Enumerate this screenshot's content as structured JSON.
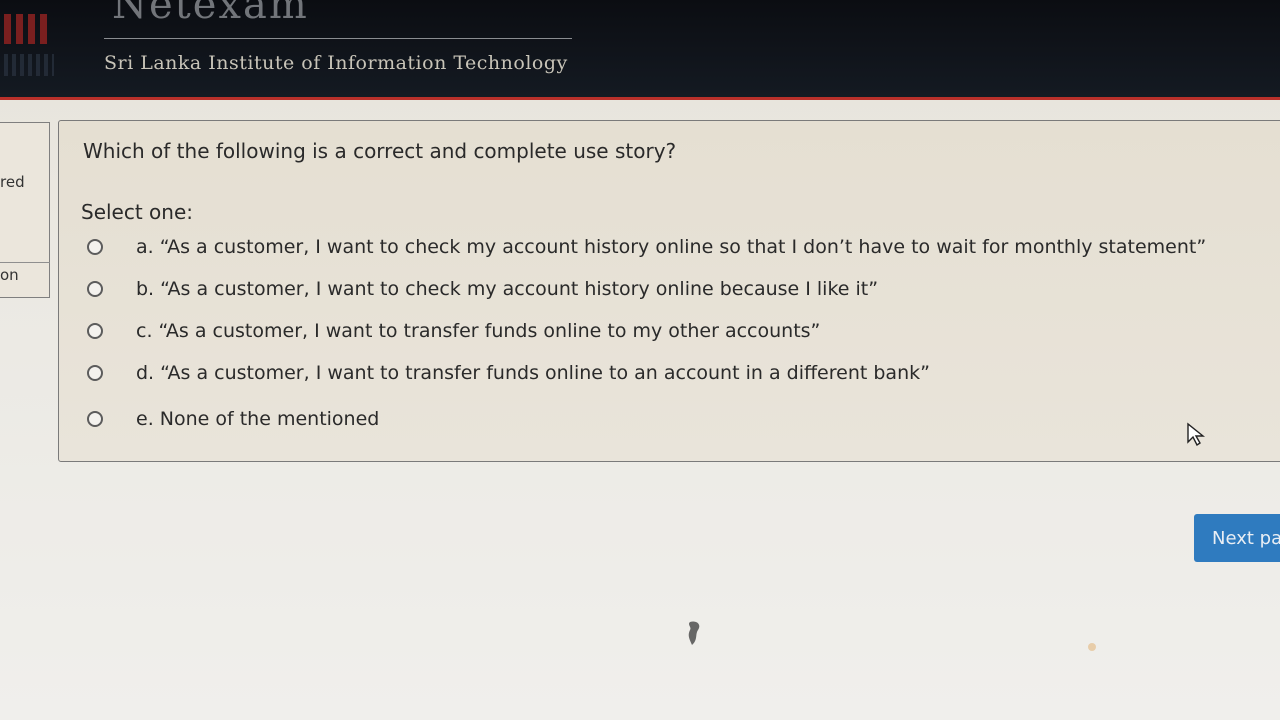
{
  "header": {
    "brand": "Netexam",
    "institute": "Sri Lanka Institute of Information Technology"
  },
  "sidebar": {
    "fragment_1": "red",
    "fragment_2": "on"
  },
  "question": {
    "text": "Which of the following is a correct and complete use story?",
    "prompt": "Select one:",
    "options": [
      {
        "label": "a. “As a customer, I want to check my account history online so that I don’t have to wait for monthly statement”",
        "selected": false
      },
      {
        "label": "b. “As a customer, I want to check my account history online because I like it”",
        "selected": false
      },
      {
        "label": "c. “As a customer, I want to transfer funds online to my other accounts”",
        "selected": false
      },
      {
        "label": "d. “As a customer, I want to transfer funds online to an account in a different bank”",
        "selected": false
      },
      {
        "label": "e. None of the mentioned",
        "selected": false
      }
    ]
  },
  "navigation": {
    "next_label": "Next pa"
  },
  "colors": {
    "header_bg": "#0e1218",
    "accent_red": "#b9302a",
    "button_blue": "#2f7bbf"
  }
}
